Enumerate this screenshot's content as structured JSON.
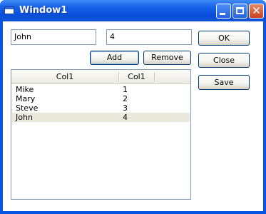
{
  "window": {
    "title": "Window1"
  },
  "form": {
    "name_value": "John",
    "number_value": "4"
  },
  "buttons": {
    "add": "Add",
    "remove": "Remove",
    "ok": "OK",
    "close": "Close",
    "save": "Save"
  },
  "list": {
    "columns": [
      "Col1",
      "Col1"
    ],
    "rows": [
      [
        "Mike",
        "1"
      ],
      [
        "Mary",
        "2"
      ],
      [
        "Steve",
        "3"
      ],
      [
        "John",
        "4"
      ]
    ],
    "selected_index": 3
  },
  "icons": {
    "app": "window-icon",
    "minimize": "minimize-icon",
    "maximize": "maximize-icon",
    "close": "close-icon"
  },
  "colors": {
    "titlebar": "#0a54e3",
    "selection": "#ebe8dc",
    "button_border": "#003c74",
    "input_border": "#7f9db9"
  }
}
